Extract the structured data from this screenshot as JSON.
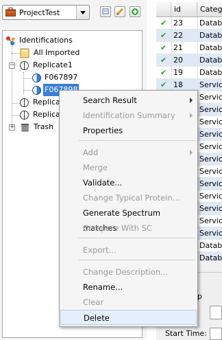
{
  "project": {
    "name": "ProjectTest"
  },
  "toolbar": {
    "icons": [
      "open-icon",
      "edit-icon",
      "add-icon"
    ]
  },
  "tree": {
    "root": "Identifications",
    "all_imported": "All Imported",
    "replicate1": "Replicate1",
    "spectra": [
      "F067897",
      "F067898"
    ],
    "replicate_b": "Replicat",
    "replicate_c": "Replicat",
    "trash": "Trash"
  },
  "table": {
    "columns": [
      "id",
      "Categ"
    ],
    "rows": [
      {
        "id": "23",
        "cat": "Databa"
      },
      {
        "id": "22",
        "cat": "Databa"
      },
      {
        "id": "21",
        "cat": "Databa"
      },
      {
        "id": "20",
        "cat": "Databa"
      },
      {
        "id": "19",
        "cat": "Databa"
      },
      {
        "id": "18",
        "cat": "Service"
      },
      {
        "id": "",
        "cat": "Service"
      },
      {
        "id": "",
        "cat": "Service"
      },
      {
        "id": "",
        "cat": "Service"
      },
      {
        "id": "",
        "cat": "Service"
      },
      {
        "id": "",
        "cat": "Service"
      },
      {
        "id": "",
        "cat": "Service"
      },
      {
        "id": "",
        "cat": "Service"
      },
      {
        "id": "",
        "cat": "Service"
      },
      {
        "id": "",
        "cat": "Service"
      },
      {
        "id": "",
        "cat": "Service"
      },
      {
        "id": "",
        "cat": "Service"
      },
      {
        "id": "",
        "cat": "Service"
      },
      {
        "id": "",
        "cat": "Databa"
      },
      {
        "id": "",
        "cat": "Databa"
      },
      {
        "id": "",
        "cat": "Databa"
      }
    ]
  },
  "lower": {
    "label_fragment": "p",
    "start_time_label": "Start Time:"
  },
  "menu": {
    "search_result": "Search Result",
    "identification_summary": "Identification Summary",
    "properties": "Properties",
    "add": "Add",
    "merge": "Merge",
    "validate": "Validate...",
    "change_typical_protein": "Change Typical Protein...",
    "generate_spectrum_matches": "Generate Spectrum matches",
    "compare_with_sc": "Compare With SC",
    "export": "Export...",
    "change_description": "Change Description...",
    "rename": "Rename...",
    "clear": "Clear",
    "delete": "Delete"
  },
  "colors": {
    "selection": "#3c7fd6",
    "check": "#2e9a2e",
    "alt_row": "#dfe8f6"
  }
}
